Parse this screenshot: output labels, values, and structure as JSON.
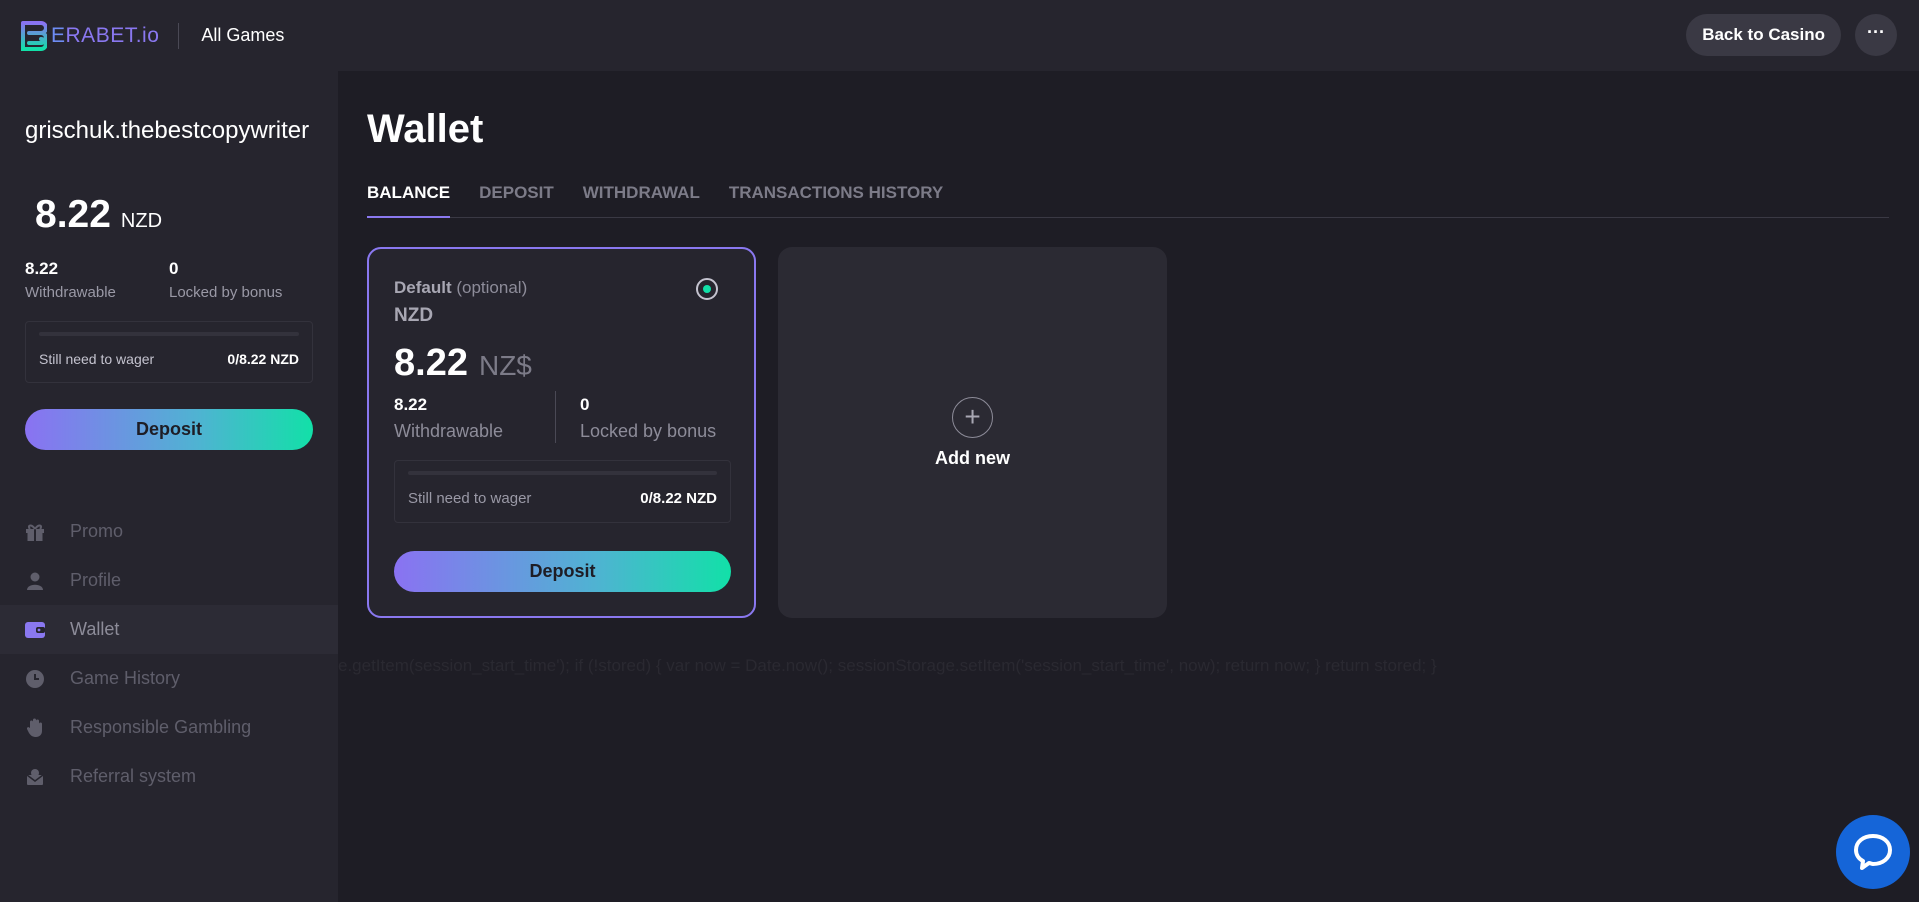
{
  "header": {
    "logo_prefix": "E",
    "logo_text": "RABET.io",
    "all_games": "All Games",
    "back_to_casino": "Back to Casino",
    "more": "···"
  },
  "sidebar": {
    "username": "grischuk.thebestcopywriter",
    "balance": "8.22",
    "currency": "NZD",
    "withdrawable_value": "8.22",
    "withdrawable_label": "Withdrawable",
    "locked_value": "0",
    "locked_label": "Locked by bonus",
    "wager_label": "Still need to wager",
    "wager_value": "0/8.22 NZD",
    "wager_progress": 0,
    "deposit": "Deposit",
    "nav": [
      {
        "label": "Promo",
        "icon": "gift-icon"
      },
      {
        "label": "Profile",
        "icon": "person-icon"
      },
      {
        "label": "Wallet",
        "icon": "wallet-icon",
        "active": true
      },
      {
        "label": "Game History",
        "icon": "clock-icon"
      },
      {
        "label": "Responsible Gambling",
        "icon": "hand-icon"
      },
      {
        "label": "Referral system",
        "icon": "referral-icon"
      }
    ]
  },
  "main": {
    "title": "Wallet",
    "tabs": [
      "BALANCE",
      "DEPOSIT",
      "WITHDRAWAL",
      "TRANSACTIONS HISTORY"
    ],
    "active_tab": "BALANCE",
    "wallet_card": {
      "default_label": "Default",
      "optional_label": "(optional)",
      "currency": "NZD",
      "amount": "8.22",
      "symbol": "NZ$",
      "withdrawable_value": "8.22",
      "withdrawable_label": "Withdrawable",
      "locked_value": "0",
      "locked_label": "Locked by bonus",
      "wager_label": "Still need to wager",
      "wager_value": "0/8.22 NZD",
      "wager_progress": 0,
      "deposit": "Deposit",
      "selected": true
    },
    "add_new": {
      "icon": "plus-icon",
      "label": "Add new"
    },
    "leaked_script": "e.getItem(session_start_time'); if (!stored) { var now = Date.now(); sessionStorage.setItem('session_start_time', now); return now; } return stored; }"
  },
  "colors": {
    "accent": "#8a78f0",
    "gradient_start": "#8a72f2",
    "gradient_end": "#12e0a8",
    "chat": "#1565d8"
  },
  "chat": {
    "icon": "chat-bubble-icon"
  }
}
